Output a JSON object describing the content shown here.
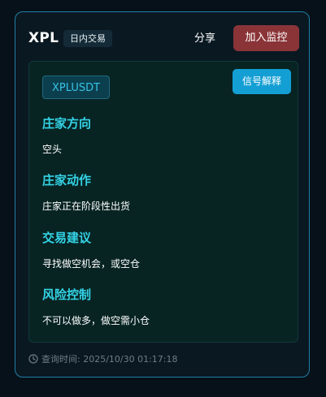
{
  "header": {
    "title": "XPL",
    "tag": "日内交易",
    "share_label": "分享",
    "monitor_label": "加入监控"
  },
  "panel": {
    "symbol": "XPLUSDT",
    "explain_label": "信号解释",
    "sections": [
      {
        "title": "庄家方向",
        "value": "空头"
      },
      {
        "title": "庄家动作",
        "value": "庄家正在阶段性出货"
      },
      {
        "title": "交易建议",
        "value": "寻找做空机会，或空仓"
      },
      {
        "title": "风险控制",
        "value": "不可以做多，做空需小仓"
      }
    ]
  },
  "footer": {
    "query_time": "查询时间: 2025/10/30 01:17:18",
    "icon": "clock-icon"
  },
  "colors": {
    "background": "#071119",
    "card_border": "#1f7fa6",
    "accent_cyan": "#34d3e6",
    "monitor_button": "#8a3438",
    "explain_button": "#149fd4"
  }
}
